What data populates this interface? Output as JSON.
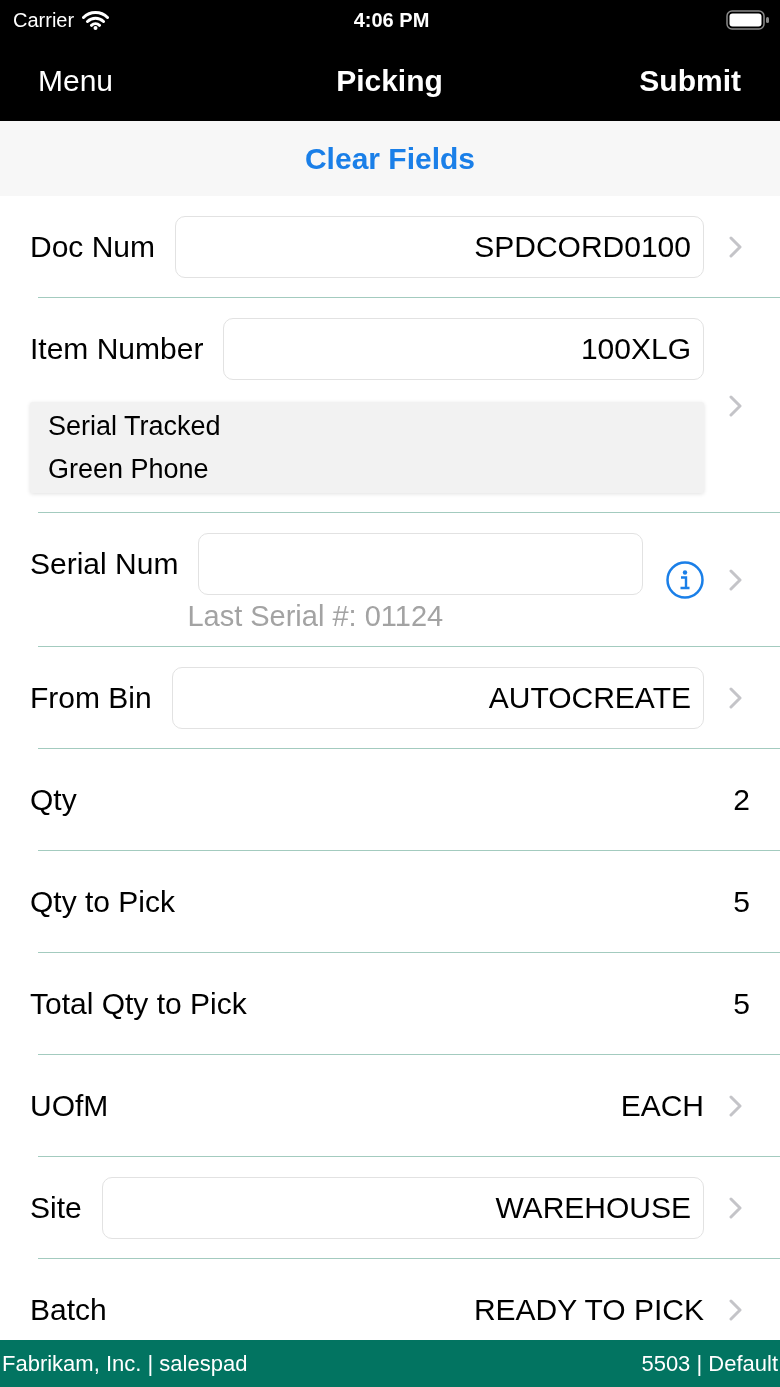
{
  "status_bar": {
    "carrier": "Carrier",
    "time": "4:06 PM"
  },
  "nav_bar": {
    "left_button": "Menu",
    "title": "Picking",
    "right_button": "Submit"
  },
  "toolbar": {
    "button": "Clear Fields"
  },
  "rows": [
    {
      "kind": "field",
      "label": "Doc Num",
      "value": "SPDCORD0100",
      "chevron": true
    },
    {
      "kind": "field",
      "label": "Item Number",
      "value": "100XLG",
      "details": [
        "Serial Tracked",
        "Green Phone"
      ],
      "chevron": true
    },
    {
      "kind": "field",
      "label": "Serial Num",
      "hint": "Last Serial #: 01124",
      "info_button": true,
      "chevron": true
    },
    {
      "kind": "field",
      "label": "From Bin",
      "value": "AUTOCREATE",
      "chevron": true
    },
    {
      "kind": "text",
      "label": "Qty",
      "value": "2",
      "chevron": false
    },
    {
      "kind": "text",
      "label": "Qty to Pick",
      "value": "5",
      "chevron": false
    },
    {
      "kind": "text",
      "label": "Total Qty to Pick",
      "value": "5",
      "chevron": false
    },
    {
      "kind": "text",
      "label": "UOfM",
      "value": "EACH",
      "chevron": true
    },
    {
      "kind": "field",
      "label": "Site",
      "value": "WAREHOUSE",
      "chevron": true
    },
    {
      "kind": "text",
      "label": "Batch",
      "value": "READY TO PICK",
      "chevron": true
    }
  ],
  "footer": {
    "left": "Fabrikam, Inc. | salespad",
    "right": "5503 | Default"
  }
}
